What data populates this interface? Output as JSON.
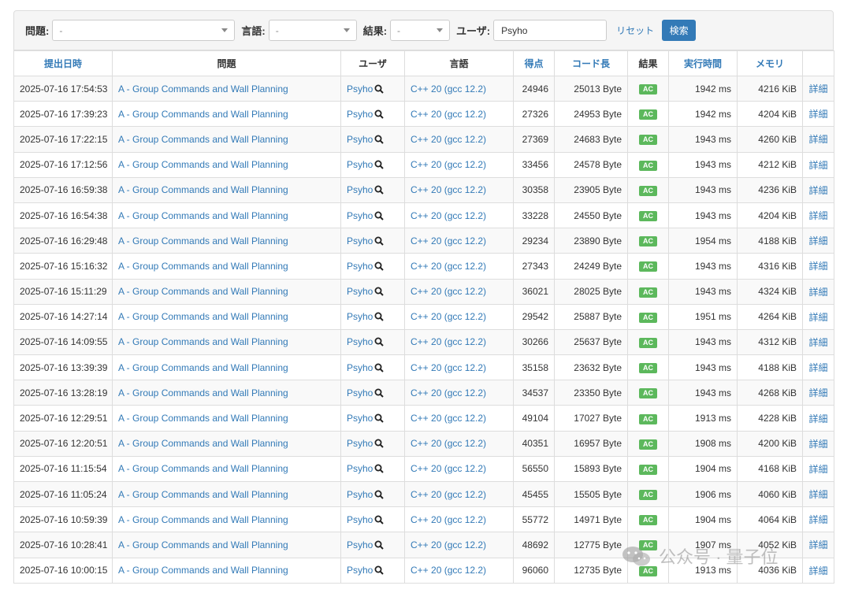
{
  "filter": {
    "problem_label": "問題:",
    "problem_value": "-",
    "language_label": "言語:",
    "language_value": "-",
    "result_label": "結果:",
    "result_value": "-",
    "user_label": "ユーザ:",
    "user_value": "Psyho",
    "reset_label": "リセット",
    "search_label": "検索"
  },
  "columns": [
    "提出日時",
    "問題",
    "ユーザ",
    "言語",
    "得点",
    "コード長",
    "結果",
    "実行時間",
    "メモリ",
    ""
  ],
  "common": {
    "problem": "A - Group Commands and Wall Planning",
    "user": "Psyho",
    "language": "C++ 20 (gcc 12.2)",
    "result": "AC",
    "detail": "詳細"
  },
  "rows": [
    {
      "date": "2025-07-16 17:54:53",
      "score": "24946",
      "code": "25013 Byte",
      "time": "1942 ms",
      "memory": "4216 KiB"
    },
    {
      "date": "2025-07-16 17:39:23",
      "score": "27326",
      "code": "24953 Byte",
      "time": "1942 ms",
      "memory": "4204 KiB"
    },
    {
      "date": "2025-07-16 17:22:15",
      "score": "27369",
      "code": "24683 Byte",
      "time": "1943 ms",
      "memory": "4260 KiB"
    },
    {
      "date": "2025-07-16 17:12:56",
      "score": "33456",
      "code": "24578 Byte",
      "time": "1943 ms",
      "memory": "4212 KiB"
    },
    {
      "date": "2025-07-16 16:59:38",
      "score": "30358",
      "code": "23905 Byte",
      "time": "1943 ms",
      "memory": "4236 KiB"
    },
    {
      "date": "2025-07-16 16:54:38",
      "score": "33228",
      "code": "24550 Byte",
      "time": "1943 ms",
      "memory": "4204 KiB"
    },
    {
      "date": "2025-07-16 16:29:48",
      "score": "29234",
      "code": "23890 Byte",
      "time": "1954 ms",
      "memory": "4188 KiB"
    },
    {
      "date": "2025-07-16 15:16:32",
      "score": "27343",
      "code": "24249 Byte",
      "time": "1943 ms",
      "memory": "4316 KiB"
    },
    {
      "date": "2025-07-16 15:11:29",
      "score": "36021",
      "code": "28025 Byte",
      "time": "1943 ms",
      "memory": "4324 KiB"
    },
    {
      "date": "2025-07-16 14:27:14",
      "score": "29542",
      "code": "25887 Byte",
      "time": "1951 ms",
      "memory": "4264 KiB"
    },
    {
      "date": "2025-07-16 14:09:55",
      "score": "30266",
      "code": "25637 Byte",
      "time": "1943 ms",
      "memory": "4312 KiB"
    },
    {
      "date": "2025-07-16 13:39:39",
      "score": "35158",
      "code": "23632 Byte",
      "time": "1943 ms",
      "memory": "4188 KiB"
    },
    {
      "date": "2025-07-16 13:28:19",
      "score": "34537",
      "code": "23350 Byte",
      "time": "1943 ms",
      "memory": "4268 KiB"
    },
    {
      "date": "2025-07-16 12:29:51",
      "score": "49104",
      "code": "17027 Byte",
      "time": "1913 ms",
      "memory": "4228 KiB"
    },
    {
      "date": "2025-07-16 12:20:51",
      "score": "40351",
      "code": "16957 Byte",
      "time": "1908 ms",
      "memory": "4200 KiB"
    },
    {
      "date": "2025-07-16 11:15:54",
      "score": "56550",
      "code": "15893 Byte",
      "time": "1904 ms",
      "memory": "4168 KiB"
    },
    {
      "date": "2025-07-16 11:05:24",
      "score": "45455",
      "code": "15505 Byte",
      "time": "1906 ms",
      "memory": "4060 KiB"
    },
    {
      "date": "2025-07-16 10:59:39",
      "score": "55772",
      "code": "14971 Byte",
      "time": "1904 ms",
      "memory": "4064 KiB"
    },
    {
      "date": "2025-07-16 10:28:41",
      "score": "48692",
      "code": "12775 Byte",
      "time": "1907 ms",
      "memory": "4052 KiB"
    },
    {
      "date": "2025-07-16 10:00:15",
      "score": "96060",
      "code": "12735 Byte",
      "time": "1913 ms",
      "memory": "4036 KiB"
    }
  ],
  "watermark": "公众号 · 量子位",
  "colors": {
    "link": "#337ab7",
    "ac_badge": "#5cb85c",
    "button": "#337ab7"
  }
}
